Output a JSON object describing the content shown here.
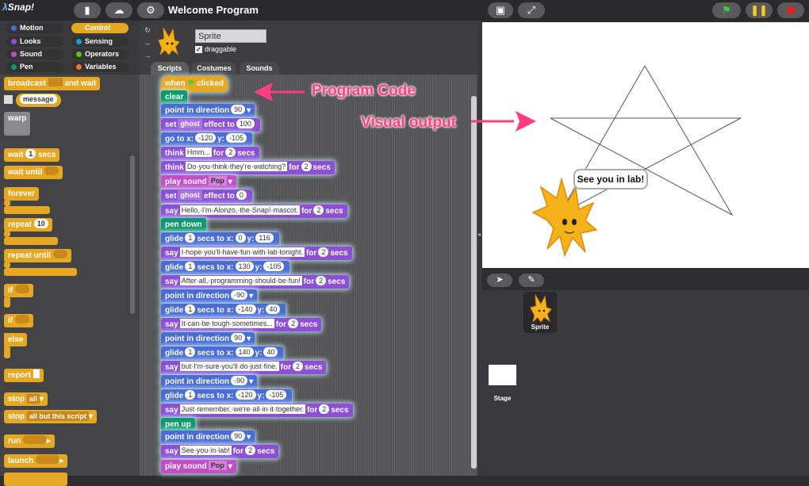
{
  "app": {
    "logo": "Snap!",
    "title": "Welcome Program"
  },
  "toolbar": {
    "file_icon": "file-icon",
    "cloud_icon": "cloud-icon",
    "settings_icon": "gear-icon"
  },
  "palette": {
    "categories": [
      "Motion",
      "Control",
      "Looks",
      "Sensing",
      "Sound",
      "Operators",
      "Pen",
      "Variables"
    ],
    "selected": "Control",
    "blocks": {
      "broadcast": "broadcast",
      "and_wait": "and wait",
      "message": "message",
      "warp": "warp",
      "wait": "wait",
      "wait_val": "1",
      "secs": "secs",
      "wait_until": "wait until",
      "forever": "forever",
      "repeat": "repeat",
      "repeat_val": "10",
      "repeat_until": "repeat until",
      "if": "if",
      "if2": "if",
      "else": "else",
      "report": "report",
      "stop": "stop",
      "stop_val": "all",
      "stop2": "stop",
      "stop2_val": "all but this script",
      "run": "run",
      "launch": "launch"
    }
  },
  "sprite": {
    "name": "Sprite",
    "draggable_label": "draggable",
    "draggable_checked": "✓"
  },
  "tabs": [
    "Scripts",
    "Costumes",
    "Sounds"
  ],
  "script": {
    "hat_when": "when",
    "hat_clicked": "clicked",
    "clear": "clear",
    "b1": {
      "lbl": "point in direction",
      "v": "90"
    },
    "b2": {
      "lbl": "set",
      "m": "ghost",
      "lbl2": "effect to",
      "v": "100"
    },
    "b3": {
      "lbl": "go to x:",
      "x": "-120",
      "lbl2": "y:",
      "y": "-105"
    },
    "b4": {
      "lbl": "think",
      "s": "Hmm...",
      "lbl2": "for",
      "v": "2",
      "lbl3": "secs"
    },
    "b5": {
      "lbl": "think",
      "s": "Do·you·think·they're·watching?",
      "lbl2": "for",
      "v": "2",
      "lbl3": "secs"
    },
    "b6": {
      "lbl": "play sound",
      "m": "Pop"
    },
    "b7": {
      "lbl": "set",
      "m": "ghost",
      "lbl2": "effect to",
      "v": "0"
    },
    "b8": {
      "lbl": "say",
      "s": "Hello,·I'm·Alonzo,·the·Snap!·mascot.",
      "lbl2": "for",
      "v": "2",
      "lbl3": "secs"
    },
    "b9": {
      "lbl": "pen down"
    },
    "b10": {
      "lbl": "glide",
      "v": "1",
      "lbl2": "secs to x:",
      "x": "0",
      "lbl3": "y:",
      "y": "116"
    },
    "b11": {
      "lbl": "say",
      "s": "I·hope·you'll·have·fun·with·lab·tonight.",
      "lbl2": "for",
      "v": "2",
      "lbl3": "secs"
    },
    "b12": {
      "lbl": "glide",
      "v": "1",
      "lbl2": "secs to x:",
      "x": "130",
      "lbl3": "y:",
      "y": "-105"
    },
    "b13": {
      "lbl": "say",
      "s": "After·all,·programming·should·be·fun!",
      "lbl2": "for",
      "v": "2",
      "lbl3": "secs"
    },
    "b14": {
      "lbl": "point in direction",
      "v": "-90"
    },
    "b15": {
      "lbl": "glide",
      "v": "1",
      "lbl2": "secs to x:",
      "x": "-140",
      "lbl3": "y:",
      "y": "40"
    },
    "b16": {
      "lbl": "say",
      "s": "It·can·be·tough·sometimes...",
      "lbl2": "for",
      "v": "2",
      "lbl3": "secs"
    },
    "b17": {
      "lbl": "point in direction",
      "v": "90"
    },
    "b18": {
      "lbl": "glide",
      "v": "1",
      "lbl2": "secs to x:",
      "x": "140",
      "lbl3": "y:",
      "y": "40"
    },
    "b19": {
      "lbl": "say",
      "s": "but·I'm·sure·you'll·do·just·fine.",
      "lbl2": "for",
      "v": "2",
      "lbl3": "secs"
    },
    "b20": {
      "lbl": "point in direction",
      "v": "-90"
    },
    "b21": {
      "lbl": "glide",
      "v": "1",
      "lbl2": "secs to x:",
      "x": "-120",
      "lbl3": "y:",
      "y": "-105"
    },
    "b22": {
      "lbl": "say",
      "s": "Just·remember,·we're·all·in·it·together.",
      "lbl2": "for",
      "v": "2",
      "lbl3": "secs"
    },
    "b23": {
      "lbl": "pen up"
    },
    "b24": {
      "lbl": "point in direction",
      "v": "90"
    },
    "b25": {
      "lbl": "say",
      "s": "See·you·in·lab!",
      "lbl2": "for",
      "v": "2",
      "lbl3": "secs"
    },
    "b26": {
      "lbl": "play sound",
      "m": "Pop"
    }
  },
  "annotations": {
    "code": "Program Code",
    "output": "Visual output"
  },
  "stage": {
    "bubble": "See you in lab!"
  },
  "corral": {
    "sprite_label": "Sprite",
    "stage_label": "Stage"
  },
  "colors": {
    "control": "#e6a822",
    "motion": "#4a6cd4",
    "looks": "#8e4fd7",
    "sound": "#c44cc9",
    "pen": "#0e9a6c",
    "annotation": "#ff3d7f"
  }
}
